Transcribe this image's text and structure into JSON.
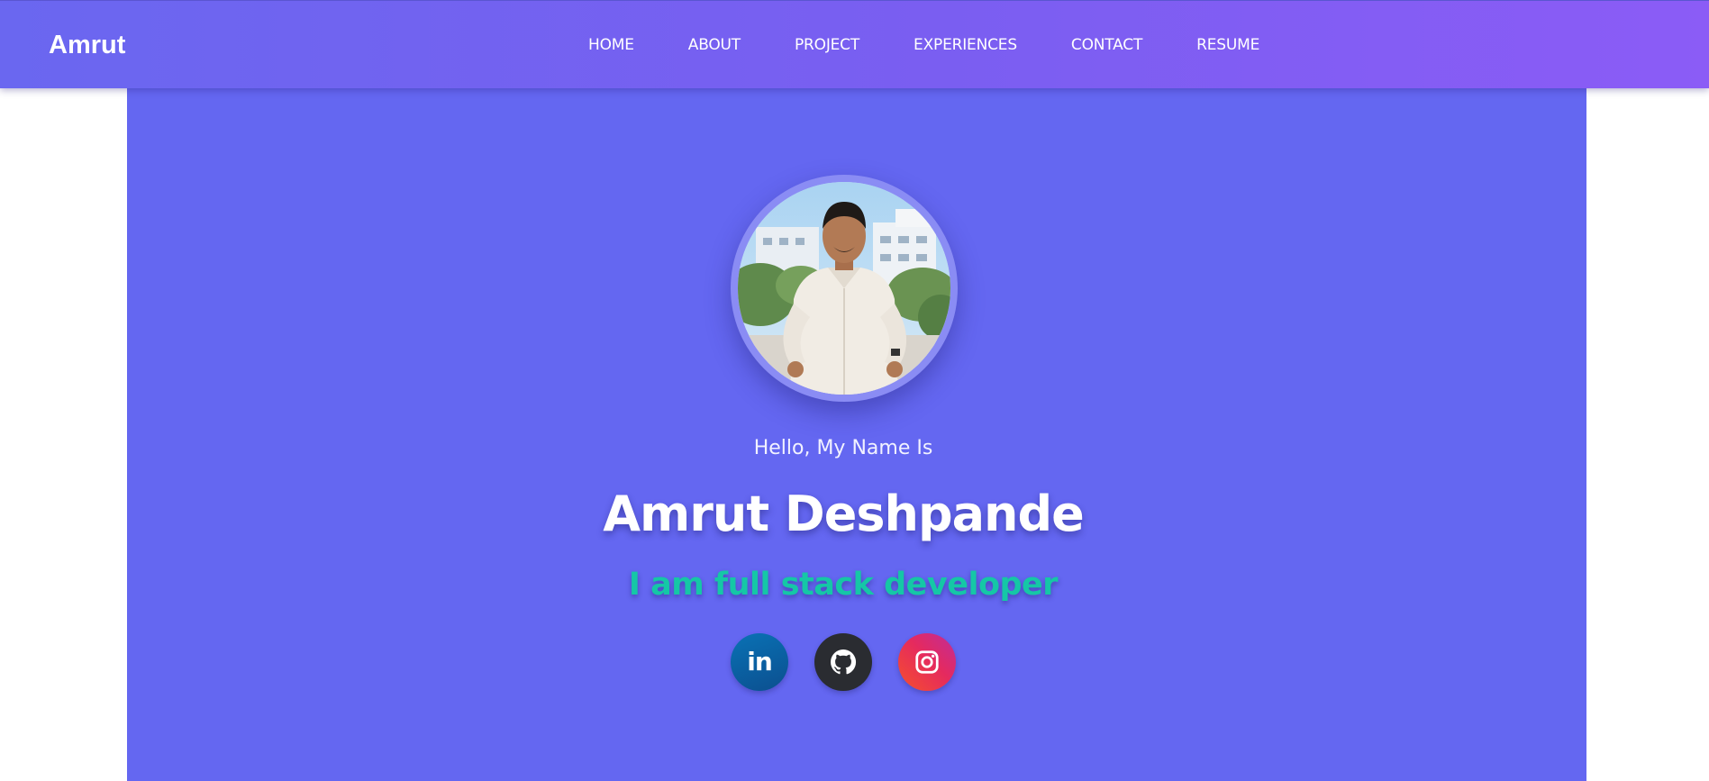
{
  "nav": {
    "brand": "Amrut",
    "links": [
      {
        "label": "HOME"
      },
      {
        "label": "ABOUT"
      },
      {
        "label": "PROJECT"
      },
      {
        "label": "EXPERIENCES"
      },
      {
        "label": "CONTACT"
      },
      {
        "label": "RESUME"
      }
    ]
  },
  "hero": {
    "greeting": "Hello, My Name Is",
    "name": "Amrut Deshpande",
    "tagline": "I am full stack developer",
    "avatar_icon": "profile-photo",
    "socials": [
      {
        "icon": "linkedin-icon",
        "label": "in"
      },
      {
        "icon": "github-icon"
      },
      {
        "icon": "instagram-icon"
      }
    ]
  },
  "colors": {
    "nav_gradient_start": "#6a67f0",
    "nav_gradient_end": "#8b5cf6",
    "hero_background": "#6467f1",
    "tagline_color": "#15c7a6",
    "text_color": "#ffffff"
  }
}
